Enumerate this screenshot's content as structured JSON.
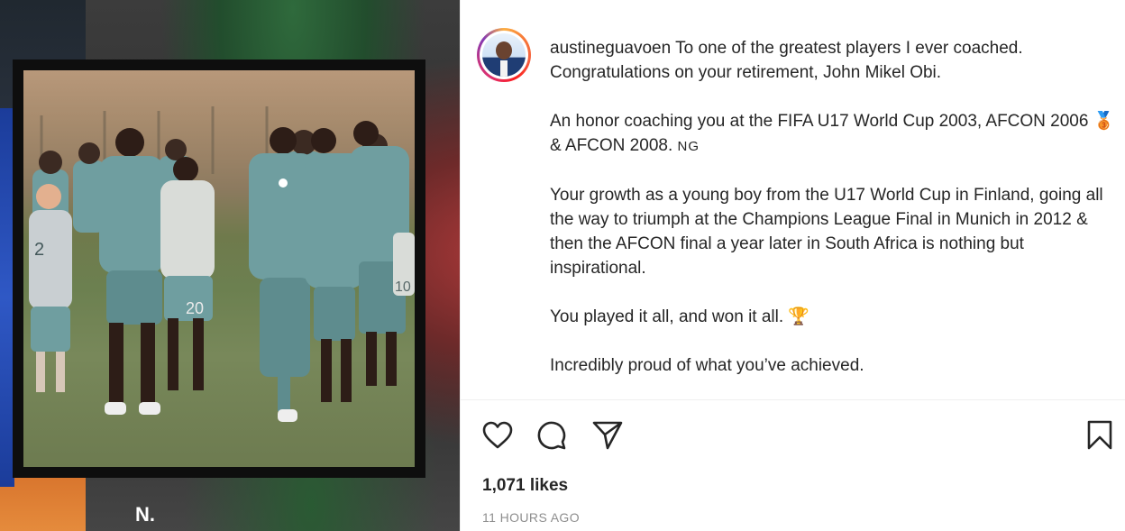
{
  "post": {
    "username": "austineguavoen",
    "caption_first": "To one of the greatest players I ever coached. Congratulations on your retirement, John Mikel Obi.",
    "para2_a": "An honor coaching you at the FIFA U17 World Cup 2003, AFCON 2006",
    "para2_emoji": "🥉",
    "para2_b": "& AFCON 2008.",
    "para2_flag": "NG",
    "para3": "Your growth as a young boy from the U17 World Cup in Finland, going all the way to triumph at the Champions League Final in Munich in 2012 & then the AFCON final a year later in South Africa is nothing but inspirational.",
    "para4_text": "You played it all, and won it all.",
    "para4_emoji": "🏆",
    "para5": "Incredibly proud of what you’ve achieved.",
    "likes": "1,071 likes",
    "timestamp": "11 HOURS AGO"
  },
  "media": {
    "background_letter": "N.",
    "jersey_numbers": [
      "2",
      "20",
      "10"
    ]
  },
  "icons": {
    "like": "heart-icon",
    "comment": "comment-icon",
    "share": "paper-plane-icon",
    "save": "bookmark-icon"
  },
  "colors": {
    "text": "#262626",
    "muted": "#8e8e8e",
    "jersey": "#6f9ea0"
  }
}
